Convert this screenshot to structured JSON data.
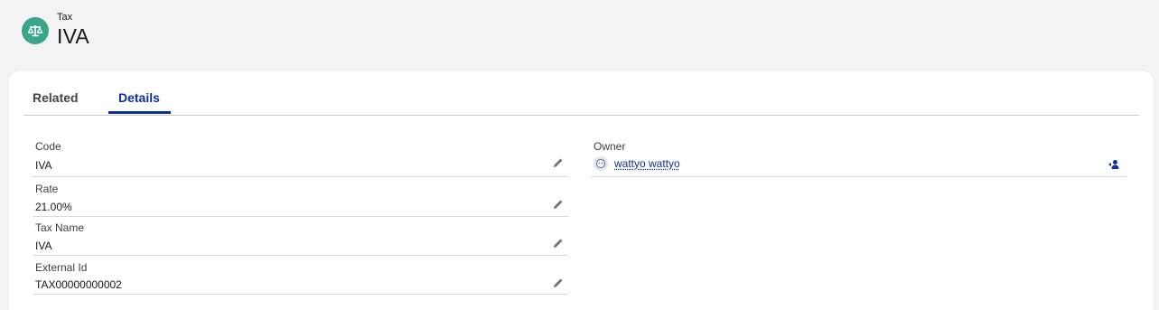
{
  "header": {
    "object_type": "Tax",
    "record_name": "IVA"
  },
  "tabs": [
    {
      "label": "Related",
      "active": false
    },
    {
      "label": "Details",
      "active": true
    }
  ],
  "fields": {
    "code": {
      "label": "Code",
      "value": "IVA"
    },
    "rate": {
      "label": "Rate",
      "value": "21.00%"
    },
    "tax_name": {
      "label": "Tax Name",
      "value": "IVA"
    },
    "external_id": {
      "label": "External Id",
      "value": "TAX00000000002"
    },
    "owner": {
      "label": "Owner",
      "value": "wattyo wattyo"
    }
  },
  "colors": {
    "accent": "#0b2f9d",
    "object_icon": "#3ba58a",
    "background": "#f3f3f3"
  },
  "icons": {
    "object": "scales-icon",
    "edit": "pencil-icon",
    "owner_avatar": "user-avatar-icon",
    "change_owner": "change-owner-icon"
  }
}
